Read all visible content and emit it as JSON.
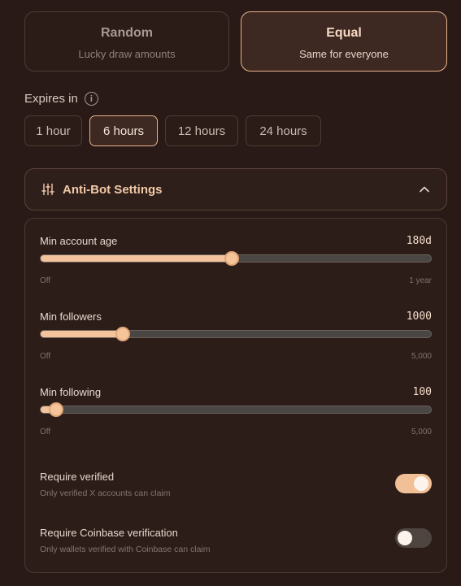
{
  "split": {
    "random": {
      "title": "Random",
      "subtitle": "Lucky draw amounts"
    },
    "equal": {
      "title": "Equal",
      "subtitle": "Same for everyone"
    },
    "selected": "equal"
  },
  "expires": {
    "label": "Expires in",
    "info_icon": "i",
    "options": [
      "1 hour",
      "6 hours",
      "12 hours",
      "24 hours"
    ],
    "selected": "6 hours"
  },
  "antibot": {
    "title": "Anti-Bot Settings",
    "icon": "sliders-icon",
    "expanded": true,
    "sliders": [
      {
        "label": "Min account age",
        "value": "180d",
        "min_label": "Off",
        "max_label": "1 year",
        "level_percent": 49
      },
      {
        "label": "Min followers",
        "value": "1000",
        "min_label": "Off",
        "max_label": "5,000",
        "level_percent": 21
      },
      {
        "label": "Min following",
        "value": "100",
        "min_label": "Off",
        "max_label": "5,000",
        "level_percent": 4
      }
    ],
    "toggles": [
      {
        "label": "Require verified",
        "description": "Only verified X accounts can claim",
        "on": true
      },
      {
        "label": "Require Coinbase verification",
        "description": "Only wallets verified with Coinbase can claim",
        "on": false
      }
    ]
  },
  "colors": {
    "accent": "#f3c49b",
    "background": "#2a1a17",
    "border_active": "#e7b18a"
  }
}
